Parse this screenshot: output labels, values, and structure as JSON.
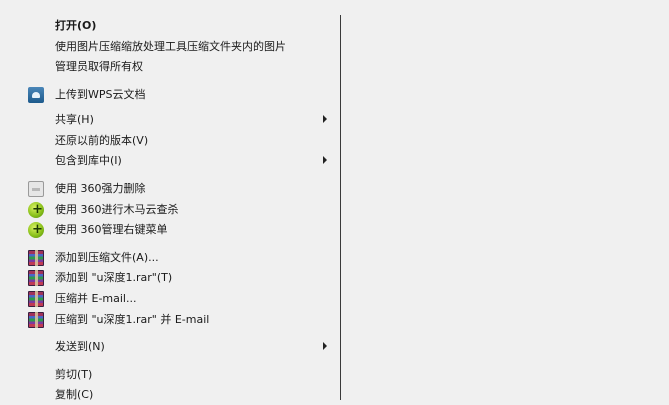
{
  "menu": {
    "open": "打开(O)",
    "compress_image": "使用图片压缩缩放处理工具压缩文件夹内的图片",
    "admin": "管理员取得所有权",
    "upload_wps": "上传到WPS云文档",
    "share": "共享(H)",
    "restore": "还原以前的版本(V)",
    "include_library": "包含到库中(I)",
    "force_delete": "使用 360强力删除",
    "trojan_scan": "使用 360进行木马云查杀",
    "manage_menu": "使用 360管理右键菜单",
    "add_archive": "添加到压缩文件(A)...",
    "add_rar": "添加到 \"u深度1.rar\"(T)",
    "compress_email": "压缩并 E-mail...",
    "compress_rar_email": "压缩到 \"u深度1.rar\" 并 E-mail",
    "send_to": "发送到(N)",
    "cut": "剪切(T)",
    "copy": "复制(C)"
  }
}
